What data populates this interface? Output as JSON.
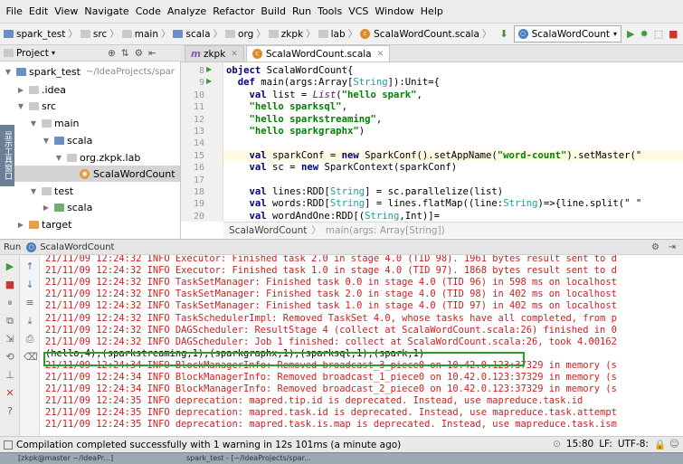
{
  "menu": [
    "File",
    "Edit",
    "View",
    "Navigate",
    "Code",
    "Analyze",
    "Refactor",
    "Build",
    "Run",
    "Tools",
    "VCS",
    "Window",
    "Help"
  ],
  "nav": {
    "crumbs": [
      "spark_test",
      "src",
      "main",
      "scala",
      "org",
      "zkpk",
      "lab",
      "ScalaWordCount.scala"
    ],
    "run_config": "ScalaWordCount"
  },
  "project": {
    "header": "Project",
    "root_name": "spark_test",
    "root_path": "~/IdeaProjects/spar",
    "items": [
      ".idea",
      "src",
      "main",
      "scala",
      "org.zkpk.lab",
      "ScalaWordCount",
      "test",
      "scala",
      "target"
    ]
  },
  "side_strip": "显示工具窗口",
  "tabs": [
    {
      "label": "zkpk",
      "icon": "m"
    },
    {
      "label": "ScalaWordCount.scala",
      "icon": "c"
    }
  ],
  "code": {
    "line_numbers": [
      "8",
      "9",
      "10",
      "11",
      "12",
      "13",
      "14",
      "15",
      "16",
      "17",
      "18",
      "19",
      "20"
    ],
    "lines": [
      {
        "indent": "",
        "parts": [
          {
            "t": "object",
            "c": "kw"
          },
          {
            "t": " ScalaWordCount{",
            "c": ""
          }
        ]
      },
      {
        "indent": "  ",
        "parts": [
          {
            "t": "def",
            "c": "kw"
          },
          {
            "t": " main(args:",
            "c": ""
          },
          {
            "t": "Array",
            "c": ""
          },
          {
            "t": "[",
            "c": ""
          },
          {
            "t": "String",
            "c": "ty"
          },
          {
            "t": "]):",
            "c": ""
          },
          {
            "t": "Unit",
            "c": ""
          },
          {
            "t": "={",
            "c": ""
          }
        ]
      },
      {
        "indent": "    ",
        "parts": [
          {
            "t": "val",
            "c": "kw"
          },
          {
            "t": " list = ",
            "c": ""
          },
          {
            "t": "List",
            "c": "fn"
          },
          {
            "t": "(",
            "c": ""
          },
          {
            "t": "\"hello spark\"",
            "c": "str"
          },
          {
            "t": ",",
            "c": ""
          }
        ]
      },
      {
        "indent": "    ",
        "parts": [
          {
            "t": "\"hello sparksql\"",
            "c": "str"
          },
          {
            "t": ",",
            "c": ""
          }
        ]
      },
      {
        "indent": "    ",
        "parts": [
          {
            "t": "\"hello sparkstreaming\"",
            "c": "str"
          },
          {
            "t": ",",
            "c": ""
          }
        ]
      },
      {
        "indent": "    ",
        "parts": [
          {
            "t": "\"hello sparkgraphx\"",
            "c": "str"
          },
          {
            "t": ")",
            "c": ""
          }
        ]
      },
      {
        "indent": "",
        "parts": []
      },
      {
        "indent": "    ",
        "parts": [
          {
            "t": "val",
            "c": "kw"
          },
          {
            "t": " sparkConf = ",
            "c": ""
          },
          {
            "t": "new",
            "c": "kw"
          },
          {
            "t": " SparkConf().setAppName(",
            "c": ""
          },
          {
            "t": "\"word-count\"",
            "c": "str"
          },
          {
            "t": ").setMaster(\"",
            "c": ""
          }
        ]
      },
      {
        "indent": "    ",
        "parts": [
          {
            "t": "val",
            "c": "kw"
          },
          {
            "t": " sc = ",
            "c": ""
          },
          {
            "t": "new",
            "c": "kw"
          },
          {
            "t": " SparkContext(sparkConf)",
            "c": ""
          }
        ]
      },
      {
        "indent": "",
        "parts": []
      },
      {
        "indent": "    ",
        "parts": [
          {
            "t": "val",
            "c": "kw"
          },
          {
            "t": " lines:RDD[",
            "c": ""
          },
          {
            "t": "String",
            "c": "ty"
          },
          {
            "t": "] = sc.parallelize(list)",
            "c": ""
          }
        ]
      },
      {
        "indent": "    ",
        "parts": [
          {
            "t": "val",
            "c": "kw"
          },
          {
            "t": " words:RDD[",
            "c": ""
          },
          {
            "t": "String",
            "c": "ty"
          },
          {
            "t": "] = lines.flatMap((line:",
            "c": ""
          },
          {
            "t": "String",
            "c": "ty"
          },
          {
            "t": ")=>{line.split(\" \"",
            "c": ""
          }
        ]
      },
      {
        "indent": "    ",
        "parts": [
          {
            "t": "val",
            "c": "kw"
          },
          {
            "t": " wordAndOne:RDD[(",
            "c": ""
          },
          {
            "t": "String",
            "c": "ty"
          },
          {
            "t": ",Int)]=",
            "c": ""
          }
        ]
      }
    ]
  },
  "breadcrumb": {
    "object": "ScalaWordCount",
    "method": "main(args: Array[String])"
  },
  "run": {
    "label": "Run",
    "config": "ScalaWordCount"
  },
  "console": [
    {
      "text": "21/11/09 12:24:32 INFO Executor: Finished task 2.0 in stage 4.0 (TID 98). 1961 bytes result sent to d",
      "type": "err"
    },
    {
      "text": "21/11/09 12:24:32 INFO Executor: Finished task 1.0 in stage 4.0 (TID 97). 1868 bytes result sent to d",
      "type": "err"
    },
    {
      "text": "21/11/09 12:24:32 INFO TaskSetManager: Finished task 0.0 in stage 4.0 (TID 96) in 598 ms on localhost",
      "type": "err"
    },
    {
      "text": "21/11/09 12:24:32 INFO TaskSetManager: Finished task 2.0 in stage 4.0 (TID 98) in 402 ms on localhost",
      "type": "err"
    },
    {
      "text": "21/11/09 12:24:32 INFO TaskSetManager: Finished task 1.0 in stage 4.0 (TID 97) in 402 ms on localhost",
      "type": "err"
    },
    {
      "text": "21/11/09 12:24:32 INFO TaskSchedulerImpl: Removed TaskSet 4.0, whose tasks have all completed, from p",
      "type": "err"
    },
    {
      "text": "21/11/09 12:24:32 INFO DAGScheduler: ResultStage 4 (collect at ScalaWordCount.scala:26) finished in 0",
      "type": "err"
    },
    {
      "text": "21/11/09 12:24:32 INFO DAGScheduler: Job 1 finished: collect at ScalaWordCount.scala:26, took 4.00162",
      "type": "err"
    },
    {
      "text": "(hello,4),(sparkstreaming,1),(sparkgraphx,1),(sparksql,1),(spark,1)",
      "type": "out"
    },
    {
      "text": "21/11/09 12:24:34 INFO BlockManagerInfo: Removed broadcast_3_piece0 on 10.42.0.123:37329 in memory (s",
      "type": "err"
    },
    {
      "text": "21/11/09 12:24:34 INFO BlockManagerInfo: Removed broadcast_1_piece0 on 10.42.0.123:37329 in memory (s",
      "type": "err"
    },
    {
      "text": "21/11/09 12:24:34 INFO BlockManagerInfo: Removed broadcast_2_piece0 on 10.42.0.123:37329 in memory (s",
      "type": "err"
    },
    {
      "text": "21/11/09 12:24:35 INFO deprecation: mapred.tip.id is deprecated. Instead, use mapreduce.task.id",
      "type": "err"
    },
    {
      "text": "21/11/09 12:24:35 INFO deprecation: mapred.task.id is deprecated. Instead, use mapreduce.task.attempt",
      "type": "err"
    },
    {
      "text": "21/11/09 12:24:35 INFO deprecation: mapred.task.is.map is deprecated. Instead, use mapreduce.task.ism",
      "type": "err"
    }
  ],
  "status": {
    "message": "Compilation completed successfully with 1 warning in 12s 101ms (a minute ago)",
    "position": "15:80",
    "line_sep": "LF:",
    "encoding": "UTF-8:"
  },
  "taskbar": {
    "items": [
      "[zkpk@master ~/IdeaPr...]",
      "spark_test - [~/IdeaProjects/spar..."
    ]
  },
  "colors": {
    "accent": "#2f9a2f",
    "log_red": "#cc1f1f",
    "keyword": "#000080",
    "string": "#008000"
  }
}
